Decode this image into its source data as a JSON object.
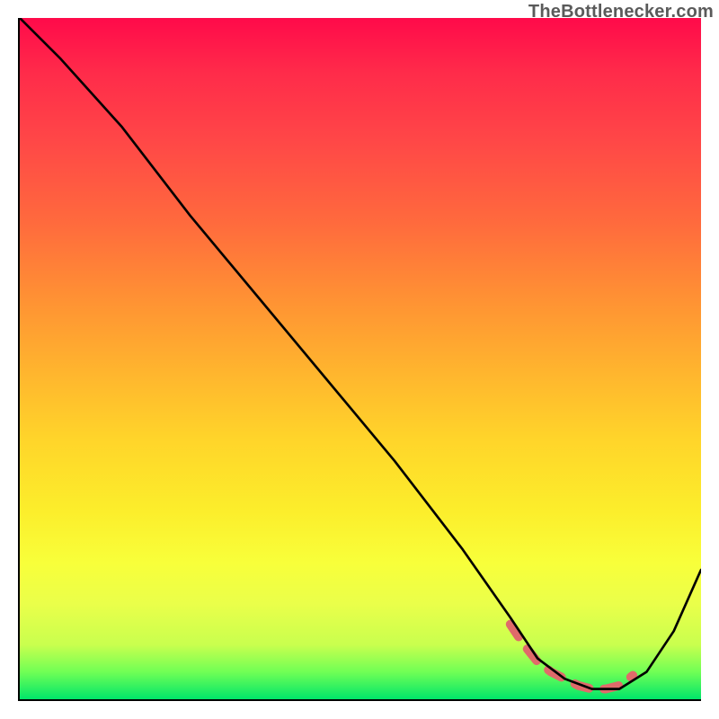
{
  "chart_data": {
    "type": "line",
    "title": "",
    "xlabel": "",
    "ylabel": "",
    "xlim": [
      0,
      100
    ],
    "ylim": [
      0,
      100
    ],
    "grid": false,
    "legend": false,
    "series": [
      {
        "name": "main-curve",
        "color": "#000000",
        "x": [
          0,
          6,
          15,
          25,
          35,
          45,
          55,
          65,
          72,
          76,
          80,
          84,
          88,
          92,
          96,
          100
        ],
        "y": [
          100,
          94,
          84,
          71,
          59,
          47,
          35,
          22,
          12,
          6,
          3,
          1.5,
          1.5,
          4,
          10,
          19
        ]
      },
      {
        "name": "marker-band",
        "color": "#e06a6a",
        "x": [
          72,
          74,
          76,
          78,
          80,
          82,
          84,
          86,
          88,
          90
        ],
        "y": [
          11,
          8,
          5.5,
          4,
          3,
          2,
          1.5,
          1.5,
          2,
          3.5
        ]
      }
    ],
    "annotations": [
      {
        "name": "watermark",
        "text": "TheBottlenecker.com",
        "position": "top-right"
      }
    ]
  },
  "ui": {
    "watermark": "TheBottlenecker.com"
  }
}
